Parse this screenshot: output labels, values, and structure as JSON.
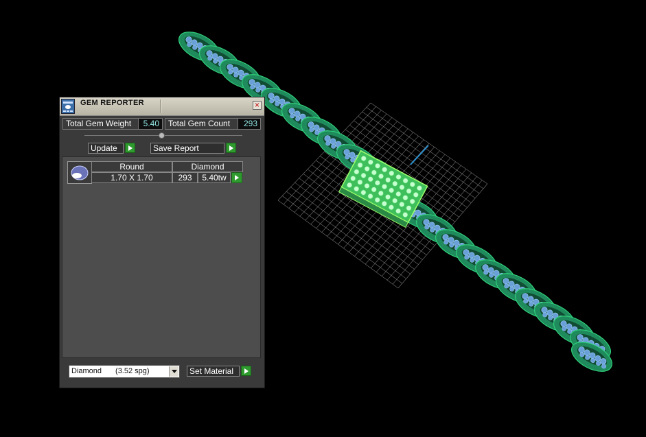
{
  "panel": {
    "title": "GEM REPORTER",
    "close_glyph": "×",
    "total_gem_weight_label": "Total Gem Weight",
    "total_gem_weight_value": "5.40",
    "total_gem_count_label": "Total Gem Count",
    "total_gem_count_value": "293",
    "update_label": "Update",
    "save_report_label": "Save Report",
    "table": {
      "headers": [
        "Round",
        "Diamond"
      ],
      "rows": [
        {
          "size": "1.70 X 1.70",
          "count": "293",
          "weight": "5.40tw"
        }
      ]
    },
    "material_select": {
      "value": "Diamond",
      "spg": "(3.52 spg)"
    },
    "set_material_label": "Set Material"
  },
  "icons": [
    "gem-reporter-icon",
    "close-icon",
    "slider-thumb",
    "arrow-right-icon",
    "chevron-down-icon",
    "gem-shape-icon"
  ],
  "colors": {
    "background": "#000000",
    "chain_green": "#1f8a5c",
    "chain_edge": "#2fd07a",
    "gem_blue": "#6aa0d8",
    "clasp_highlight": "#9dff6a",
    "grid": "#9a9a9a",
    "value_text": "#8fe3e0",
    "button_green": "#2f9b2f"
  }
}
